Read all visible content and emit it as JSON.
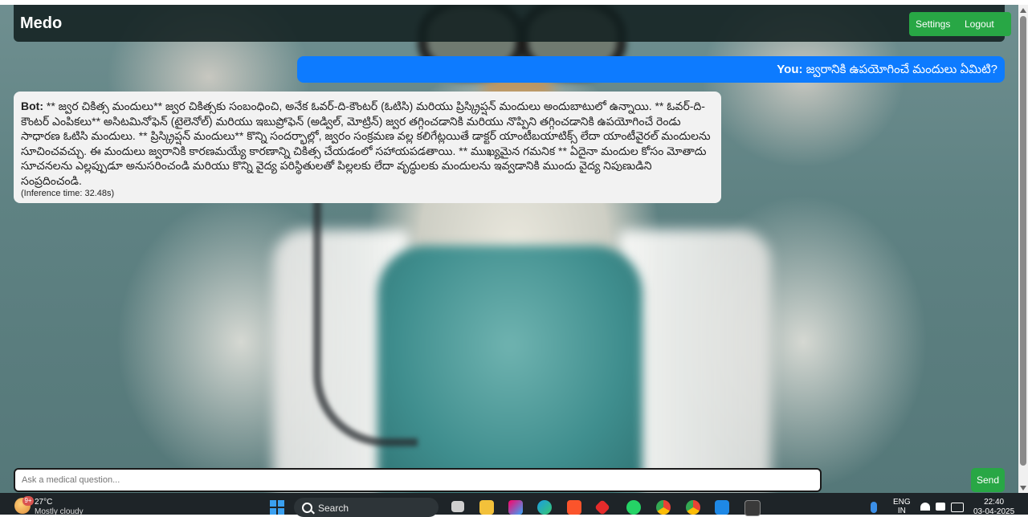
{
  "header": {
    "brand": "Medo",
    "settings_label": "Settings",
    "logout_label": "Logout"
  },
  "messages": {
    "user": {
      "speaker": "You:",
      "text": "జ్వరానికి ఉపయోగించే మందులు ఏమిటి?"
    },
    "bot": {
      "speaker": "Bot:",
      "text": "** జ్వర చికిత్స మందులు** జ్వర చికిత్సకు సంబంధించి, అనేక ఓవర్-ది-కౌంటర్ (ఓటిసి) మరియు ప్రిస్క్రిప్షన్ మందులు అందుబాటులో ఉన్నాయి. ** ఓవర్-ది-కౌంటర్ ఎంపికలు** అసిటమినోఫెన్ (టైలెనోల్) మరియు ఇబుప్రోఫెన్ (అడ్విల్, మోట్రిన్) జ్వర తగ్గించడానికి మరియు నొప్పిని తగ్గించడానికి ఉపయోగించే రెండు సాధారణ ఓటిసి మందులు. ** ప్రిస్క్రిప్షన్ మందులు** కొన్ని సందర్భాల్లో, జ్వరం సంక్రమణ వల్ల కలిగేట్లయితే డాక్టర్ యాంటీబయాటిక్స్ లేదా యాంటీవైరల్ మందులను సూచించవచ్చు. ఈ మందులు జ్వరానికి కారణమయ్యే కారణాన్ని చికిత్స చేయడంలో సహాయపడతాయి. ** ముఖ్యమైన గమనిక ** ఏదైనా మందుల కోసం మోతాదు సూచనలను ఎల్లప్పుడూ అనుసరించండి మరియు కొన్ని వైద్య పరిస్థితులతో పిల్లలకు లేదా వృద్ధులకు మందులను ఇవ్వడానికి ముందు వైద్య నిపుణుడిని సంప్రదించండి.",
      "inference": "(Inference time: 32.48s)"
    }
  },
  "composer": {
    "placeholder": "Ask a medical question...",
    "send_label": "Send"
  },
  "taskbar": {
    "weather_badge": "9+",
    "temperature": "27°C",
    "condition": "Mostly cloudy",
    "search_label": "Search",
    "lang_top": "ENG",
    "lang_bottom": "IN",
    "time": "22:40",
    "date": "03-04-2025"
  },
  "colors": {
    "header_bg": "#12201f",
    "accent_green": "#28a745",
    "user_bubble": "#0d7bff",
    "bot_bubble": "#f2f2f2",
    "taskbar_bg": "#1e2428"
  }
}
